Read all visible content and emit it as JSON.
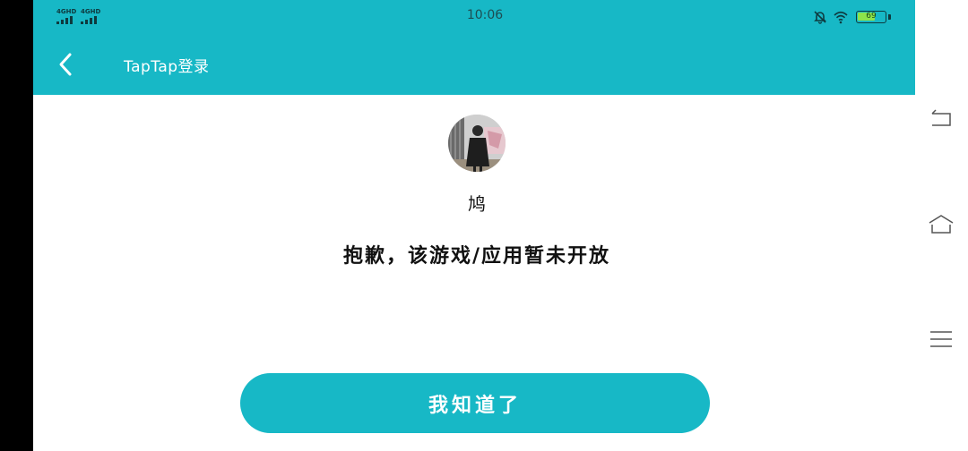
{
  "status_bar": {
    "signal_1_label": "4GHD",
    "signal_2_label": "4GHD",
    "time": "10:06",
    "battery_level": "69",
    "battery_fraction": 0.69
  },
  "header": {
    "title": "TapTap登录",
    "background_color": "#17b8c6"
  },
  "profile": {
    "username": "鸠"
  },
  "main": {
    "message": "抱歉，该游戏/应用暂未开放",
    "confirm_label": "我知道了"
  },
  "nav_bar": {
    "buttons": [
      "back-icon",
      "home-icon",
      "menu-icon"
    ]
  }
}
